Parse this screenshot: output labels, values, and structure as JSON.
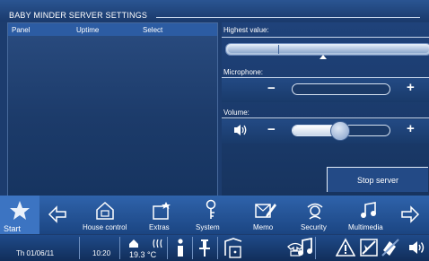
{
  "header": {
    "title": "BABY MINDER SERVER SETTINGS"
  },
  "panel_list": {
    "columns": [
      "Panel",
      "Uptime",
      "Select"
    ]
  },
  "highest_value": {
    "label": "Highest value:",
    "level_percent": 100
  },
  "microphone": {
    "label": "Microphone:",
    "minus": "−",
    "plus": "+",
    "level_percent": 0
  },
  "volume": {
    "label": "Volume:",
    "minus": "−",
    "plus": "+",
    "level_percent": 48
  },
  "stop_button": {
    "label": "Stop server"
  },
  "nav": {
    "start": "Start",
    "house_control": "House control",
    "extras": "Extras",
    "system": "System",
    "memo": "Memo",
    "security": "Security",
    "multimedia": "Multimedia"
  },
  "status": {
    "date": "Th 01/06/11",
    "time": "10:20",
    "temperature": "19.3 °C"
  },
  "colors": {
    "background": "#1c3c6e",
    "accent": "#2c5ca3",
    "text": "#ffffff"
  },
  "icons": [
    "star-icon",
    "arrow-left-icon",
    "house-icon",
    "extras-icon",
    "system-icon",
    "memo-icon",
    "security-icon",
    "multimedia-icon",
    "arrow-right-icon",
    "home-small-icon",
    "heating-icon",
    "info-icon",
    "pin-icon",
    "door-icon",
    "phone-icon",
    "music-icon",
    "warning-icon",
    "no-disturb-icon",
    "mute-icon",
    "speaker-icon"
  ]
}
